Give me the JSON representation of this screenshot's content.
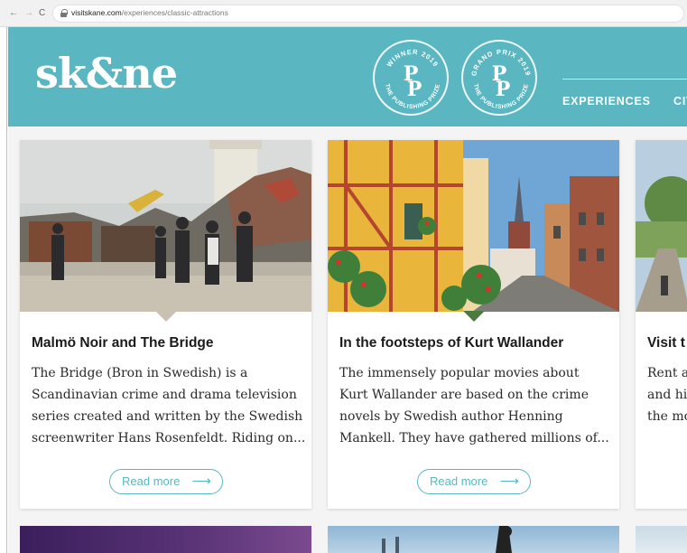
{
  "browser": {
    "url_domain": "visitskane.com",
    "url_path": "/experiences/classic-attractions",
    "back_label": "←",
    "forward_label": "→",
    "reload_label": "C"
  },
  "header": {
    "logo": "sk&ne",
    "badges": [
      {
        "top": "WINNER 2019",
        "letters": "P P",
        "bottom": "THE PUBLISHING PRIZE"
      },
      {
        "top": "GRAND PRIX 2019",
        "letters": "P P",
        "bottom": "THE PUBLISHING PRIZE"
      }
    ],
    "nav": [
      "EXPERIENCES",
      "CIT"
    ]
  },
  "cards": [
    {
      "title": "Malmö Noir and The Bridge",
      "description_lines": [
        "The Bridge (Bron in Swedish) is a",
        "Scandinavian crime and drama television",
        "series created and written by the Swedish",
        "screenwriter Hans Rosenfeldt. Riding on..."
      ],
      "read_more": "Read more",
      "arrow": "⟶"
    },
    {
      "title": "In the footsteps of Kurt Wallander",
      "description_lines": [
        "The immensely popular movies about",
        "Kurt Wallander are based on the crime",
        "novels by Swedish author Henning",
        "Mankell. They have gathered millions of..."
      ],
      "read_more": "Read more",
      "arrow": "⟶"
    },
    {
      "title": "Visit t",
      "description_lines": [
        "Rent a",
        "and hi",
        "the mo"
      ]
    }
  ],
  "colors": {
    "brand_teal": "#5ab7c2",
    "text_dark": "#1b1b1b"
  }
}
